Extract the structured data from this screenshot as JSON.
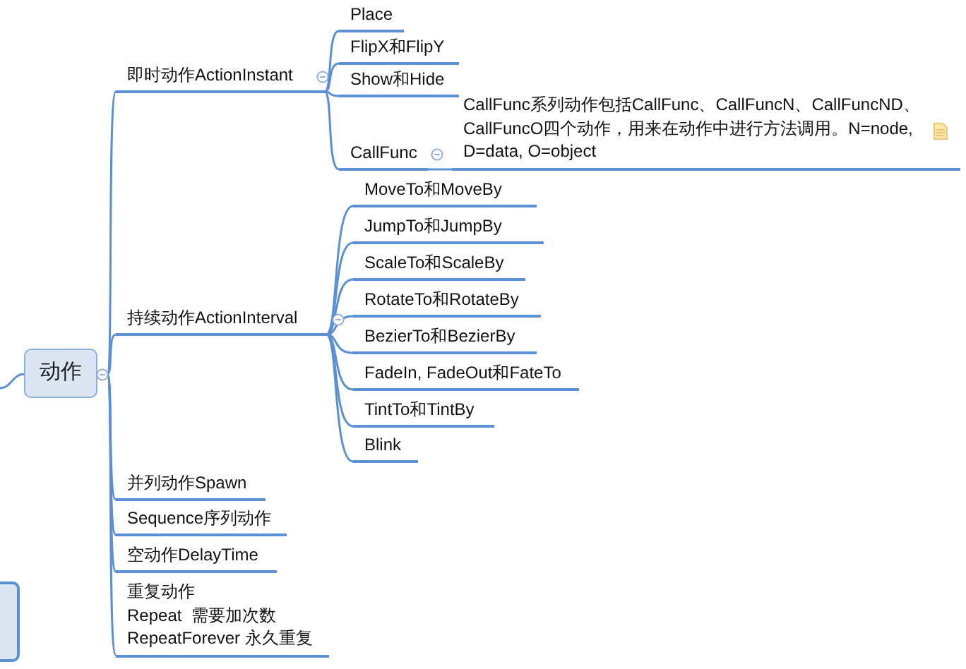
{
  "root": {
    "label": "动作",
    "collapsed": false
  },
  "branches": [
    {
      "label": "即时动作ActionInstant",
      "collapsed": false,
      "children": [
        {
          "label": "Place"
        },
        {
          "label": "FlipX和FlipY"
        },
        {
          "label": "Show和Hide"
        },
        {
          "label": "CallFunc",
          "collapsed": false,
          "note": {
            "text": "CallFunc系列动作包括CallFunc、CallFuncN、CallFuncND、CallFuncO四个动作，用来在动作中进行方法调用。N=node, D=data, O=object",
            "has_icon": true
          }
        }
      ]
    },
    {
      "label": "持续动作ActionInterval",
      "collapsed": false,
      "children": [
        {
          "label": "MoveTo和MoveBy"
        },
        {
          "label": "JumpTo和JumpBy"
        },
        {
          "label": "ScaleTo和ScaleBy"
        },
        {
          "label": "RotateTo和RotateBy"
        },
        {
          "label": "BezierTo和BezierBy"
        },
        {
          "label": "FadeIn, FadeOut和FateTo"
        },
        {
          "label": "TintTo和TintBy"
        },
        {
          "label": "Blink"
        }
      ]
    },
    {
      "label": "并列动作Spawn"
    },
    {
      "label": "Sequence序列动作"
    },
    {
      "label": "空动作DelayTime"
    },
    {
      "label": "重复动作\nRepeat  需要加次数\nRepeatForever 永久重复"
    }
  ]
}
